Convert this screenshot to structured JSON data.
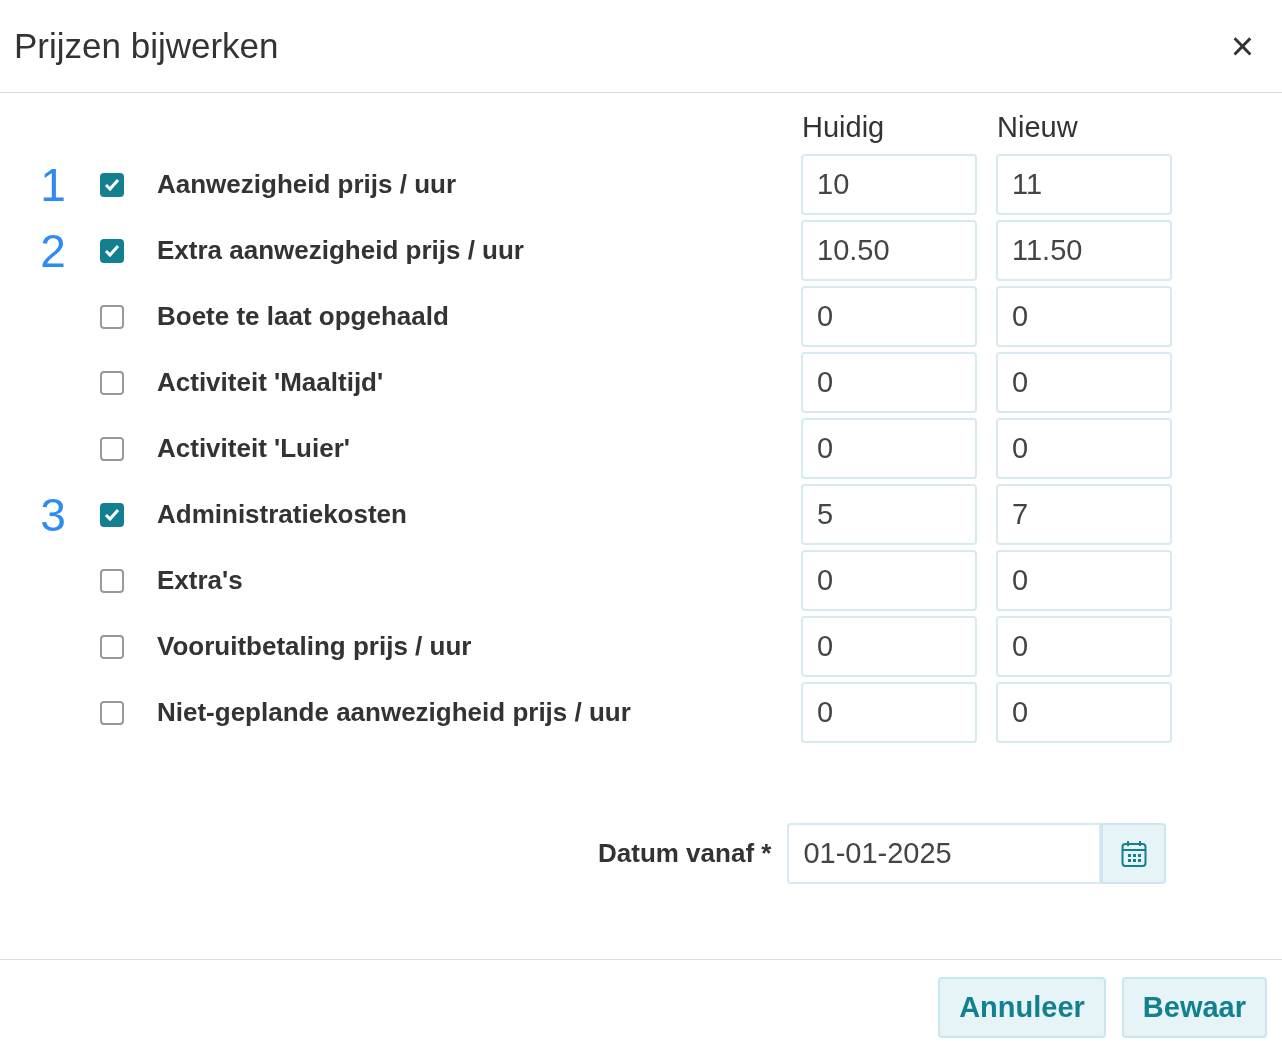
{
  "dialog": {
    "title": "Prijzen bijwerken",
    "close": "×"
  },
  "columns": [
    "Huidig",
    "Nieuw"
  ],
  "rows": [
    {
      "marker": "1",
      "checked": true,
      "label": "Aanwezigheid prijs / uur",
      "current": "10",
      "new": "11"
    },
    {
      "marker": "2",
      "checked": true,
      "label": "Extra aanwezigheid prijs / uur",
      "current": "10.50",
      "new": "11.50"
    },
    {
      "checked": false,
      "label": "Boete te laat opgehaald",
      "current": "0",
      "new": "0"
    },
    {
      "checked": false,
      "label": "Activiteit 'Maaltijd'",
      "current": "0",
      "new": "0"
    },
    {
      "checked": false,
      "label": "Activiteit 'Luier'",
      "current": "0",
      "new": "0"
    },
    {
      "marker": "3",
      "checked": true,
      "label": "Administratiekosten",
      "current": "5",
      "new": "7"
    },
    {
      "checked": false,
      "label": "Extra's",
      "current": "0",
      "new": "0"
    },
    {
      "checked": false,
      "label": "Vooruitbetaling prijs / uur",
      "current": "0",
      "new": "0"
    },
    {
      "checked": false,
      "label": "Niet-geplande aanwezigheid prijs / uur",
      "current": "0",
      "new": "0"
    }
  ],
  "date": {
    "label": "Datum vanaf *",
    "value": "01-01-2025"
  },
  "buttons": [
    "Annuleer",
    "Bewaar"
  ]
}
